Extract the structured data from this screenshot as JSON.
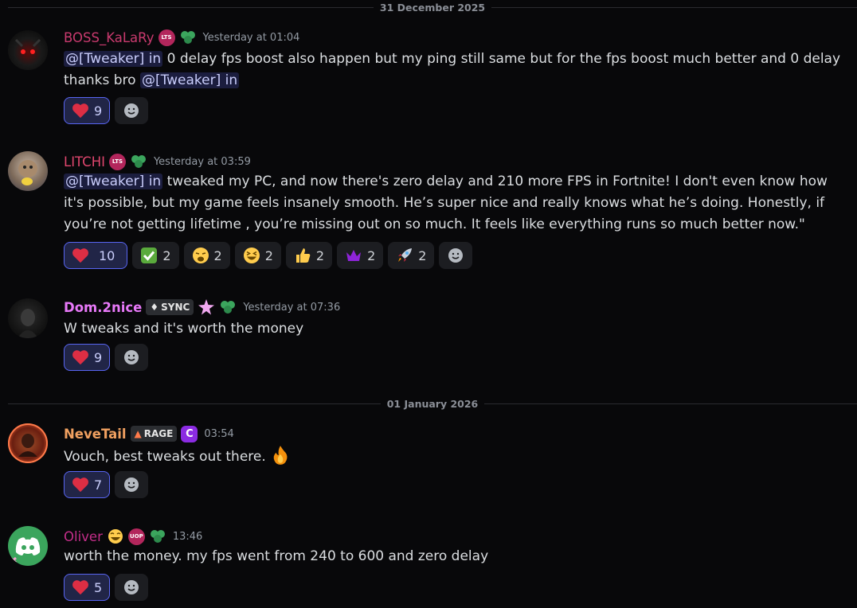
{
  "dividers": [
    "31 December 2025",
    "01 January 2026"
  ],
  "messages": [
    {
      "username": "BOSS_KaLaRy",
      "badge": "LTS",
      "time": "Yesterday at 01:04",
      "mention": "@[Tweaker] in",
      "text_a": " 0 delay fps boost also happen but my ping still same but for the fps boost much better and 0 delay thanks bro ",
      "reactions": [
        {
          "emoji": "heart",
          "count": "9"
        }
      ]
    },
    {
      "username": "LITCHI",
      "badge": "LTS",
      "time": "Yesterday at 03:59",
      "mention": "@[Tweaker] in",
      "text": "  tweaked my PC, and now there's zero delay and 210 more FPS in Fortnite! I don't even know how it's possible, but my game feels insanely smooth. He’s super nice and really knows what he’s doing. Honestly, if you’re not getting lifetime , you’re missing out on so much. It feels like everything runs so much better now.\"",
      "reactions": [
        {
          "emoji": "heart",
          "count": "10"
        },
        {
          "emoji": "check-mark",
          "count": "2"
        },
        {
          "emoji": "weary-face",
          "count": "2"
        },
        {
          "emoji": "grinning-squint-face",
          "count": "2"
        },
        {
          "emoji": "thumbs-up",
          "count": "2"
        },
        {
          "emoji": "crown",
          "count": "2"
        },
        {
          "emoji": "rocket",
          "count": "2"
        }
      ]
    },
    {
      "username": "Dom.2nice",
      "tag": "SYNC",
      "time": "Yesterday at 07:36",
      "text": "W tweaks and it's worth the money",
      "reactions": [
        {
          "emoji": "heart",
          "count": "9"
        }
      ]
    },
    {
      "username": "NeveTail",
      "tag": "RAGE",
      "time": "03:54",
      "text": "Vouch, best tweaks out there. ",
      "reactions": [
        {
          "emoji": "heart",
          "count": "7"
        }
      ]
    },
    {
      "username": "Oliver",
      "badge": "UOP",
      "time": "13:46",
      "text": "worth the money. my fps went from 240 to 600 and zero delay",
      "reactions": [
        {
          "emoji": "heart",
          "count": "5"
        }
      ]
    }
  ],
  "colors": {
    "background": "#08080a",
    "boss_name": "#c93a6e",
    "litchi_name": "#e0466e",
    "dom_name": "#e879f9",
    "neve_name": "#f0a060",
    "oliver_name": "#c42e8a",
    "reaction_selected_border": "#5865f2",
    "mention_text": "#c9cdfb"
  }
}
